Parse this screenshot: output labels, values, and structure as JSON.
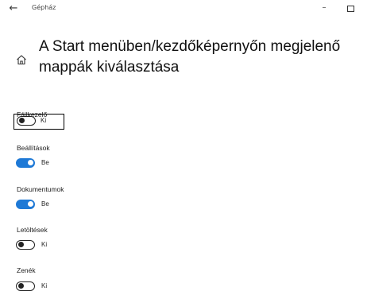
{
  "window": {
    "title": "Gépház",
    "back_glyph": "←",
    "minimize_glyph": "–"
  },
  "header": {
    "title": "A Start menüben/kezdőképernyőn megjelenő mappák kiválasztása",
    "icon": "home-icon"
  },
  "settings": [
    {
      "label": "Fájlkezelő",
      "state": "Ki",
      "on": false,
      "focused": true
    },
    {
      "label": "Beállítások",
      "state": "Be",
      "on": true,
      "focused": false
    },
    {
      "label": "Dokumentumok",
      "state": "Be",
      "on": true,
      "focused": false
    },
    {
      "label": "Letöltések",
      "state": "Ki",
      "on": false,
      "focused": false
    },
    {
      "label": "Zenék",
      "state": "Ki",
      "on": false,
      "focused": false
    }
  ],
  "colors": {
    "accent": "#1e79d6",
    "toggle_off": "#222222"
  }
}
